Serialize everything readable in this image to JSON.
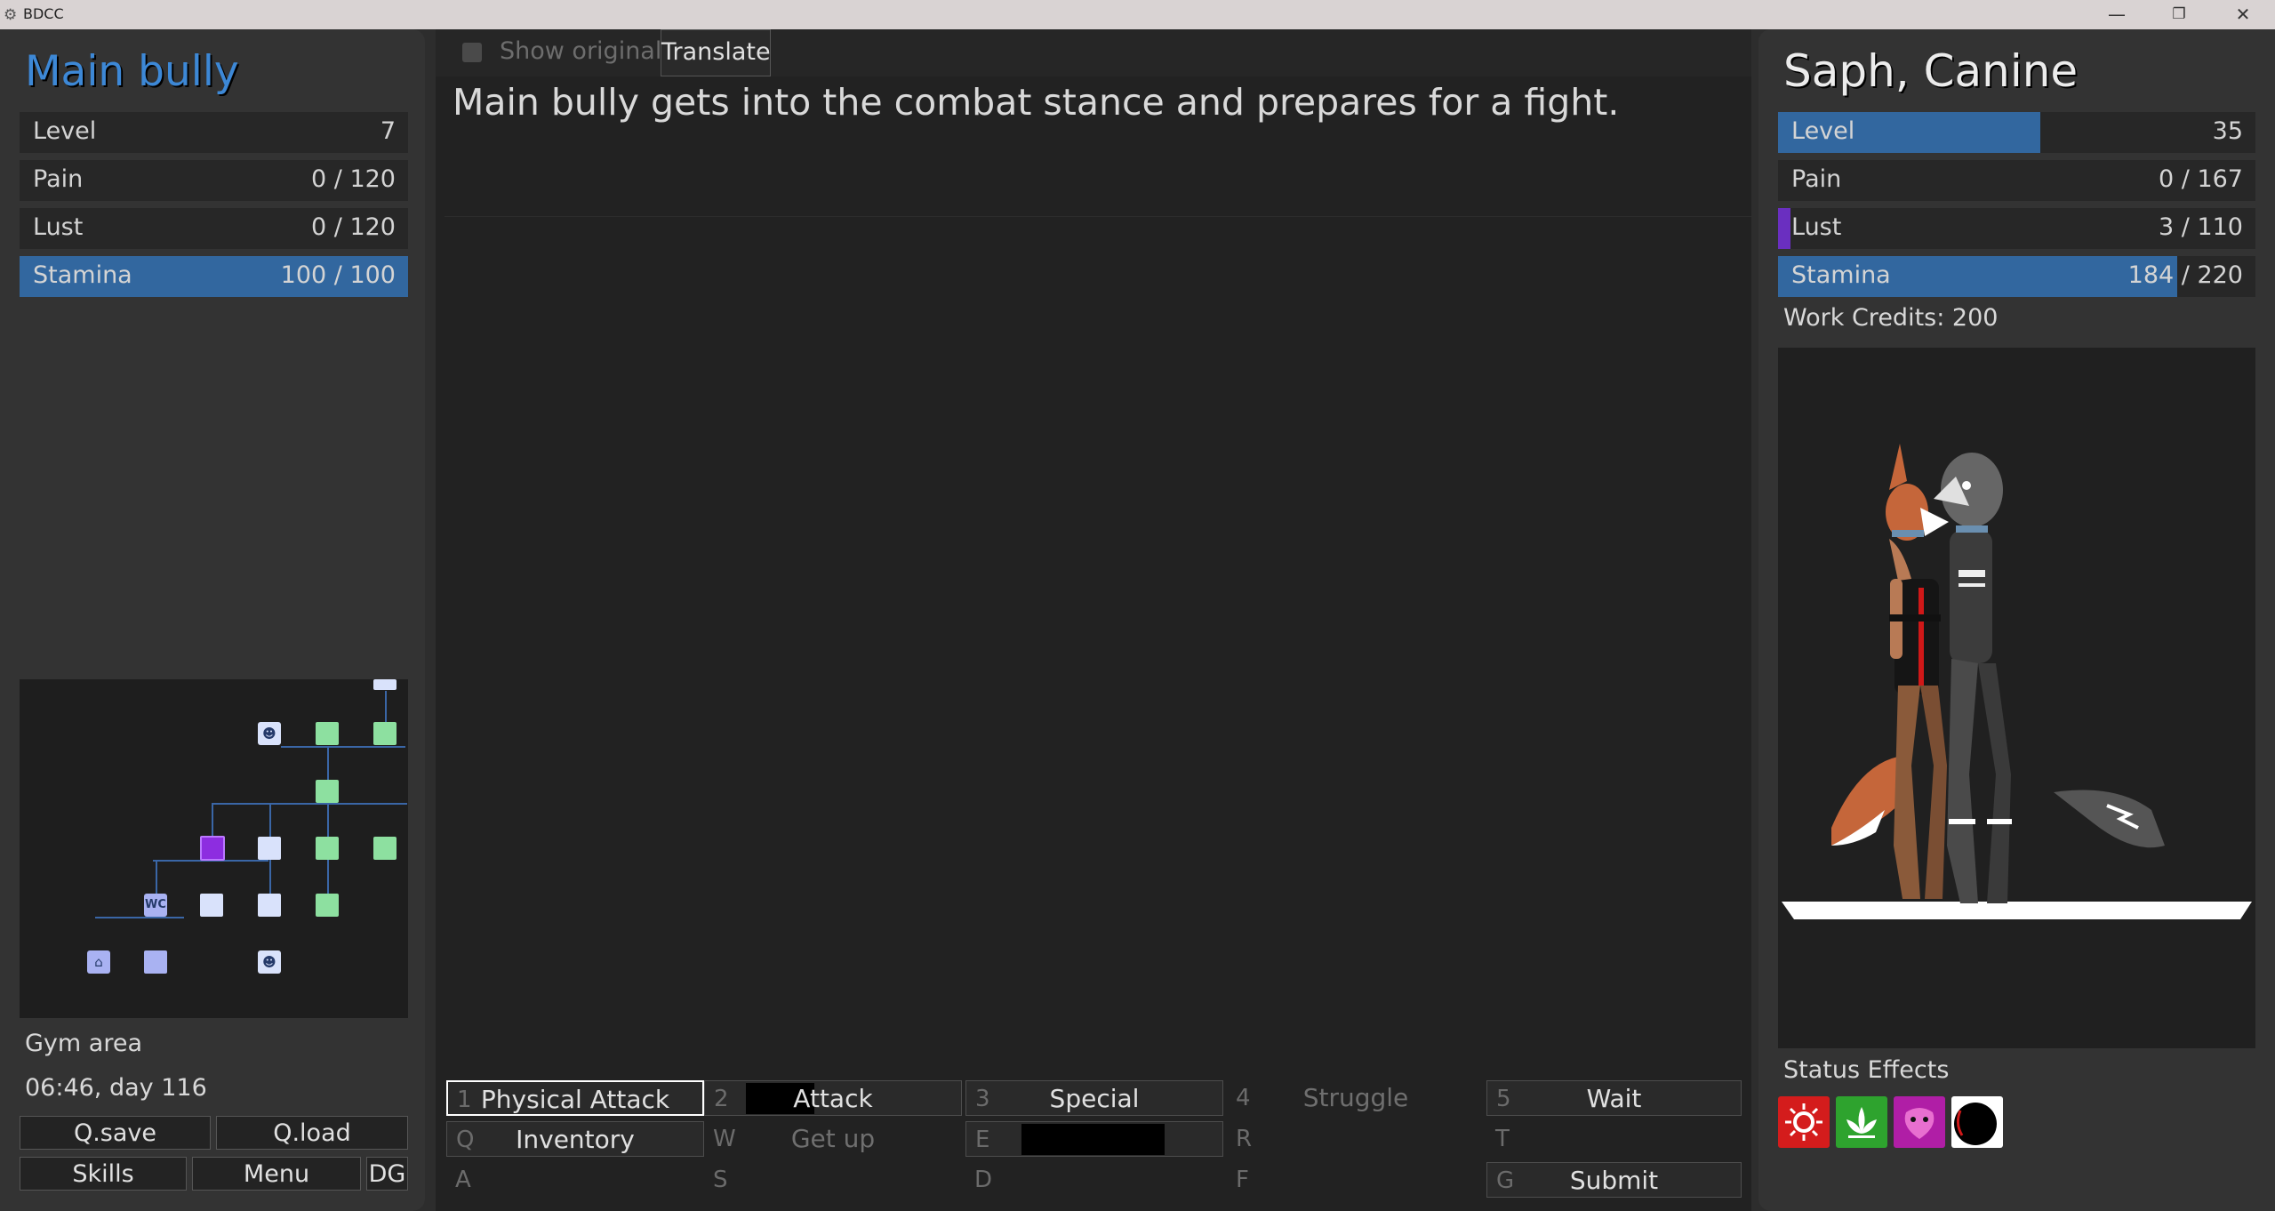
{
  "window": {
    "title": "BDCC",
    "app_icon": "gear-icon"
  },
  "left": {
    "name": "Main bully",
    "stats": [
      {
        "label": "Level",
        "value": "7",
        "fill": 0
      },
      {
        "label": "Pain",
        "value": "0 / 120",
        "fill": 0
      },
      {
        "label": "Lust",
        "value": "0 / 120",
        "fill": 0
      },
      {
        "label": "Stamina",
        "value": "100 / 100",
        "fill": 1.0
      }
    ],
    "location": "Gym area",
    "time": "06:46, day 116",
    "buttons": {
      "qsave": "Q.save",
      "qload": "Q.load",
      "skills": "Skills",
      "menu": "Menu",
      "dg": "DG"
    },
    "minimap": {
      "wc_label": "WC"
    }
  },
  "center": {
    "show_original": "Show original",
    "translate": "Translate",
    "story_text": "Main bully gets into the combat stance and prepares for a fight.",
    "actions": [
      {
        "key": "1",
        "label": "Physical Attack"
      },
      {
        "key": "2",
        "label": "Attack"
      },
      {
        "key": "3",
        "label": "Special"
      },
      {
        "key": "4",
        "label": "Struggle"
      },
      {
        "key": "5",
        "label": "Wait"
      },
      {
        "key": "Q",
        "label": "Inventory"
      },
      {
        "key": "W",
        "label": "Get up"
      },
      {
        "key": "E",
        "label": ""
      },
      {
        "key": "R",
        "label": ""
      },
      {
        "key": "T",
        "label": ""
      },
      {
        "key": "A",
        "label": ""
      },
      {
        "key": "S",
        "label": ""
      },
      {
        "key": "D",
        "label": ""
      },
      {
        "key": "F",
        "label": ""
      },
      {
        "key": "G",
        "label": "Submit"
      }
    ]
  },
  "right": {
    "name": "Saph, Canine",
    "stats": [
      {
        "label": "Level",
        "value": "35",
        "fill": 0.55,
        "color": "#32679f"
      },
      {
        "label": "Pain",
        "value": "0 / 167",
        "fill": 0,
        "color": "#32679f"
      },
      {
        "label": "Lust",
        "value": "3 / 110",
        "fill": 0.027,
        "color": "#6a2fc0"
      },
      {
        "label": "Stamina",
        "value": "184 / 220",
        "fill": 0.836,
        "color": "#32679f"
      }
    ],
    "credits": "Work Credits: 200",
    "status_title": "Status Effects",
    "status_icons": [
      "red-burst-icon",
      "lotus-icon",
      "pink-creature-icon",
      "black-orb-icon"
    ]
  },
  "colors": {
    "accent": "#32679f",
    "name_blue": "#3d88d6",
    "lust_purple": "#6a2fc0"
  }
}
